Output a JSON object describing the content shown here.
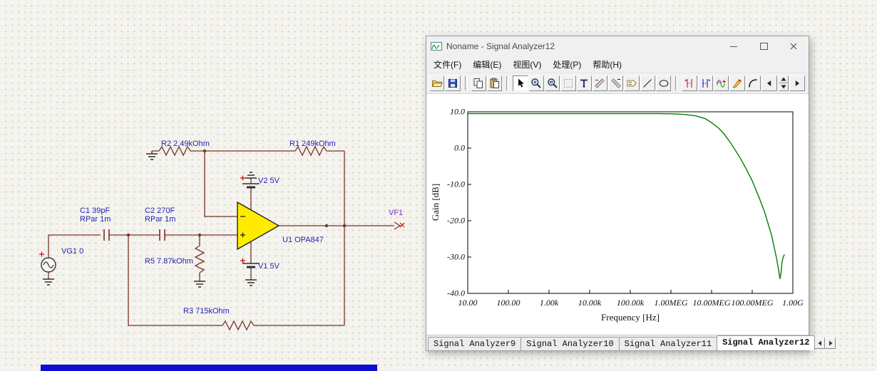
{
  "schematic": {
    "labels": {
      "vg1": "VG1 0",
      "c1_name": "C1 39pF",
      "c1_rpar": "RPar 1m",
      "c2_name": "C2 270F",
      "c2_rpar": "RPar 1m",
      "r5": "R5 7.87kOhm",
      "r2": "R2 2.49kOhm",
      "r1": "R1 249kOhm",
      "r3": "R3 715kOhm",
      "v2": "V2 5V",
      "v1": "V1 5V",
      "u1": "U1 OPA847",
      "vf1": "VF1"
    },
    "colors": {
      "wire": "#7a3226",
      "label": "#2323b8",
      "vf1_label": "#7b2fbe",
      "opamp_fill": "#ffec00"
    }
  },
  "window": {
    "title": "Noname - Signal Analyzer12",
    "menu_items": [
      {
        "label": "文件(F)"
      },
      {
        "label": "编辑(E)"
      },
      {
        "label": "视图(V)"
      },
      {
        "label": "处理(P)"
      },
      {
        "label": "帮助(H)"
      }
    ],
    "toolbar_icons": [
      "open-folder",
      "save",
      "copy",
      "paste",
      "select-cursor",
      "zoom-in",
      "zoom-100",
      "grid",
      "text-tool",
      "ruler-a",
      "ruler-b",
      "label-tag",
      "line-tool",
      "ellipse-tool",
      "cursor-a-marker",
      "cursor-b-marker",
      "curves",
      "pen",
      "arc",
      "prev-curve",
      "curve-spinner",
      "next-curve"
    ],
    "tabs": [
      {
        "label": "Signal Analyzer9",
        "active": false
      },
      {
        "label": "Signal Analyzer10",
        "active": false
      },
      {
        "label": "Signal Analyzer11",
        "active": false
      },
      {
        "label": "Signal Analyzer12",
        "active": true
      }
    ]
  },
  "chart": {
    "y_axis_label": "Gain [dB]",
    "x_axis_label": "Frequency [Hz]",
    "y_ticks": [
      "10.0",
      "0.0",
      "-10.0",
      "-20.0",
      "-30.0",
      "-40.0"
    ],
    "x_ticks": [
      "10.00",
      "100.00",
      "1.00k",
      "10.00k",
      "100.00k",
      "1.00MEG",
      "10.00MEG",
      "100.00MEG",
      "1.00G"
    ]
  },
  "chart_data": {
    "type": "line",
    "title": "",
    "xlabel": "Frequency [Hz]",
    "ylabel": "Gain [dB]",
    "x_scale": "log",
    "xlim": [
      10,
      1000000000
    ],
    "ylim": [
      -40,
      10
    ],
    "grid": false,
    "legend": false,
    "series": [
      {
        "name": "Gain",
        "color": "#008000",
        "points": [
          [
            10,
            9.5
          ],
          [
            100,
            9.5
          ],
          [
            1000,
            9.5
          ],
          [
            10000,
            9.5
          ],
          [
            100000,
            9.5
          ],
          [
            500000,
            9.5
          ],
          [
            1000000,
            9.45
          ],
          [
            2000000,
            9.3
          ],
          [
            4000000,
            8.9
          ],
          [
            7000000,
            8.1
          ],
          [
            10000000,
            7.0
          ],
          [
            15000000,
            5.5
          ],
          [
            20000000,
            4.0
          ],
          [
            30000000,
            1.3
          ],
          [
            50000000,
            -2.6
          ],
          [
            70000000,
            -5.6
          ],
          [
            100000000,
            -9.0
          ],
          [
            150000000,
            -13.8
          ],
          [
            200000000,
            -17.5
          ],
          [
            300000000,
            -24.0
          ],
          [
            400000000,
            -30.5
          ],
          [
            450000000,
            -33.8
          ],
          [
            480000000,
            -36.0
          ],
          [
            510000000,
            -34.5
          ],
          [
            540000000,
            -31.5
          ],
          [
            580000000,
            -30.0
          ],
          [
            620000000,
            -29.3
          ]
        ]
      }
    ]
  }
}
